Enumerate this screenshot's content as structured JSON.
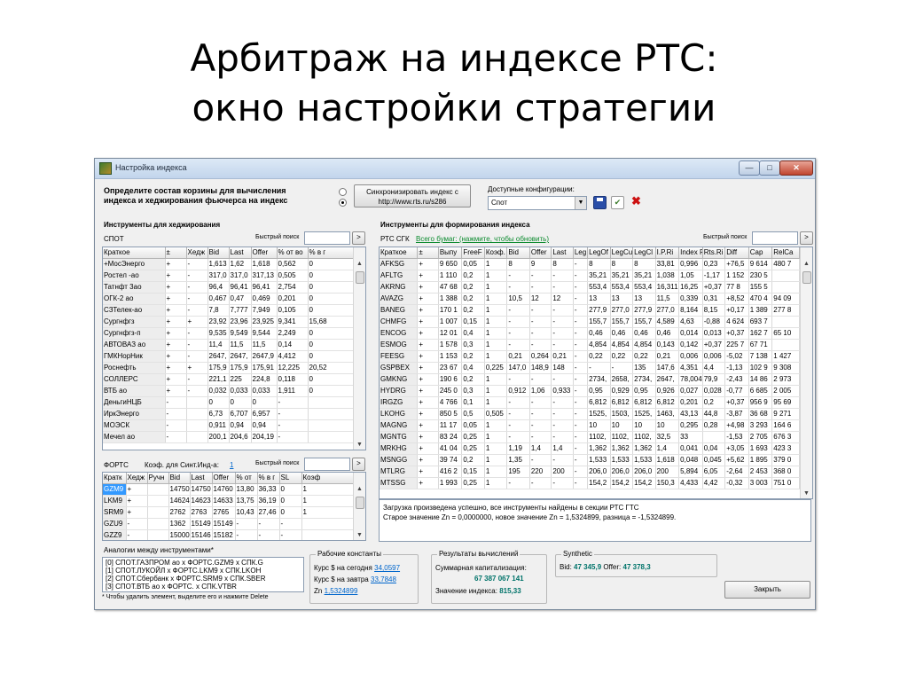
{
  "slide": {
    "title_line1": "Арбитраж на индексе РТС:",
    "title_line2": "окно настройки стратегии"
  },
  "window": {
    "title": "Настройка индекса",
    "min": "—",
    "max": "□",
    "close": "✕"
  },
  "top": {
    "define_line1": "Определите состав корзины для вычисления",
    "define_line2": "индекса и хеджирования фьючерса на индекс",
    "sync_line1": "Синхронизировать индекс с",
    "sync_line2": "http://www.rts.ru/s286",
    "configs_label": "Доступные конфигурации:",
    "config_value": "Спот",
    "config_arrow": "▼",
    "save_icon": "save-icon",
    "check_icon": "check-icon",
    "delete_icon": "delete-icon",
    "delete_glyph": "✖",
    "check_glyph": "✔"
  },
  "hedge": {
    "heading": "Инструменты для хеджирования",
    "section": "СПОТ",
    "quick_search": "Быстрый поиск",
    "go": ">",
    "columns": [
      "Краткое",
      "±",
      "Хедж",
      "Bid",
      "Last",
      "Offer",
      "% от во",
      "% в г"
    ],
    "rows": [
      [
        "+МосЭнерго",
        "+",
        "-",
        "1,613",
        "1,62",
        "1,618",
        "0,562",
        "0"
      ],
      [
        "Ростел -ао",
        "+",
        "-",
        "317,0",
        "317,0",
        "317,13",
        "0,505",
        "0"
      ],
      [
        "Татнфт 3ао",
        "+",
        "-",
        "96,4",
        "96,41",
        "96,41",
        "2,754",
        "0"
      ],
      [
        "ОГК-2 ао",
        "+",
        "-",
        "0,467",
        "0,47",
        "0,469",
        "0,201",
        "0"
      ],
      [
        "СЗТелек-ао",
        "+",
        "-",
        "7,8",
        "7,777",
        "7,949",
        "0,105",
        "0"
      ],
      [
        "Сургнфгз",
        "+",
        "+",
        "23,92",
        "23,96",
        "23,925",
        "9,341",
        "15,68"
      ],
      [
        "Сургнфгз-п",
        "+",
        "-",
        "9,535",
        "9,549",
        "9,544",
        "2,249",
        "0"
      ],
      [
        "АВТОВАЗ ао",
        "+",
        "-",
        "11,4",
        "11,5",
        "11,5",
        "0,14",
        "0"
      ],
      [
        "ГМКНорНик",
        "+",
        "-",
        "2647,",
        "2647,",
        "2647,9",
        "4,412",
        "0"
      ],
      [
        "Роснефть",
        "+",
        "+",
        "175,9",
        "175,9",
        "175,91",
        "12,225",
        "20,52"
      ],
      [
        "СОЛЛЕРС",
        "+",
        "-",
        "221,1",
        "225",
        "224,8",
        "0,118",
        "0"
      ],
      [
        "ВТБ ао",
        "+",
        "-",
        "0,032",
        "0,033",
        "0,033",
        "1,911",
        "0"
      ],
      [
        "ДеньгиНЦБ",
        "-",
        "",
        "0",
        "0",
        "0",
        "-",
        ""
      ],
      [
        "ИркЭнерго",
        "-",
        "",
        "6,73",
        "6,707",
        "6,957",
        "-",
        ""
      ],
      [
        "МОЭСК",
        "-",
        "",
        "0,911",
        "0,94",
        "0,94",
        "-",
        ""
      ],
      [
        "Мечел ао",
        "-",
        "",
        "200,1",
        "204,6",
        "204,19",
        "-",
        ""
      ]
    ]
  },
  "forts": {
    "section": "ФОРТС",
    "coef_label": "Коэф. для Синт.Инд-а:",
    "coef_value": "1",
    "quick_search": "Быстрый поиск",
    "go": ">",
    "columns": [
      "Кратк",
      "Хедж",
      "Ручн",
      "Bid",
      "Last",
      "Offer",
      "% от",
      "% в г",
      "SL",
      "Коэф"
    ],
    "rows": [
      [
        "GZM9",
        "+",
        "",
        "14750",
        "14750",
        "14760",
        "13,80",
        "36,33",
        "0",
        "1"
      ],
      [
        "LKM9",
        "+",
        "",
        "14624",
        "14623",
        "14633",
        "13,75",
        "36,19",
        "0",
        "1"
      ],
      [
        "SRM9",
        "+",
        "",
        "2762",
        "2763",
        "2765",
        "10,43",
        "27,46",
        "0",
        "1"
      ],
      [
        "GZU9",
        "-",
        "",
        "1362",
        "15149",
        "15149",
        "-",
        "-",
        "-",
        ""
      ],
      [
        "GZZ9",
        "-",
        "",
        "15000",
        "15146",
        "15182",
        "-",
        "-",
        "-",
        ""
      ]
    ]
  },
  "analogies": {
    "title": "Аналогии между инструментами*",
    "items": [
      "[0]  СПОТ.ГАЗПРОМ ао  x  ФОРТС.GZM9  x  СПК.G",
      "[1]  СПОТ.ЛУКОЙЛ  x  ФОРТС.LKM9  x  СПК.LKOH",
      "[2]  СПОТ.Сбербанк  x  ФОРТС.SRM9  x  СПК.SBER",
      "[3]  СПОТ.ВТБ ао  x  ФОРТС.  x  СПК.VTBR"
    ],
    "footnote": "* Чтобы удалить элемент, выделите его и нажмите Delete"
  },
  "index": {
    "heading": "Инструменты для формирования индекса",
    "section": "РТС СГК",
    "all_papers_link": "Всего бумаг: (нажмите, чтобы обновить)",
    "quick_search": "Быстрый поиск",
    "go": ">",
    "columns": [
      "Краткое",
      "±",
      "Выпу",
      "FreeF",
      "Коэф.",
      "Bid",
      "Offer",
      "Last",
      "Leg",
      "LegOf",
      "LegCu",
      "LegCl",
      "I.P.Ri",
      "Index P",
      "Rts.Ri",
      "Diff",
      "Cap",
      "RelCa"
    ],
    "rows": [
      [
        "AFKSG",
        "+",
        "9 650",
        "0,05",
        "1",
        "8",
        "9",
        "8",
        "-",
        "8",
        "8",
        "8",
        "33,81",
        "0,996",
        "0,23",
        "+76,5",
        "9 614",
        "480 7"
      ],
      [
        "AFLTG",
        "+",
        "1 110",
        "0,2",
        "1",
        "-",
        "-",
        "-",
        "-",
        "35,21",
        "35,21",
        "35,21",
        "1,038",
        "1,05",
        "-1,17",
        "1 152",
        "230 5"
      ],
      [
        "AKRNG",
        "+",
        "47 68",
        "0,2",
        "1",
        "-",
        "-",
        "-",
        "-",
        "553,4",
        "553,4",
        "553,4",
        "16,311",
        "16,25",
        "+0,37",
        "77 8",
        "155 5"
      ],
      [
        "AVAZG",
        "+",
        "1 388",
        "0,2",
        "1",
        "10,5",
        "12",
        "12",
        "-",
        "13",
        "13",
        "13",
        "11,5",
        "0,339",
        "0,31",
        "+8,52",
        "470 4",
        "94 09"
      ],
      [
        "BANEG",
        "+",
        "170 1",
        "0,2",
        "1",
        "-",
        "-",
        "-",
        "-",
        "277,9",
        "277,0",
        "277,9",
        "277,0",
        "8,164",
        "8,15",
        "+0,17",
        "1 389",
        "277 8"
      ],
      [
        "CHMFG",
        "+",
        "1 007",
        "0,15",
        "1",
        "-",
        "-",
        "-",
        "-",
        "155,7",
        "155,7",
        "155,7",
        "4,589",
        "4,63",
        "-0,88",
        "4 624",
        "693 7"
      ],
      [
        "ENCOG",
        "+",
        "12 01",
        "0,4",
        "1",
        "-",
        "-",
        "-",
        "-",
        "0,46",
        "0,46",
        "0,46",
        "0,46",
        "0,014",
        "0,013",
        "+0,37",
        "162 7",
        "65 10"
      ],
      [
        "ESMOG",
        "+",
        "1 578",
        "0,3",
        "1",
        "-",
        "-",
        "-",
        "-",
        "4,854",
        "4,854",
        "4,854",
        "0,143",
        "0,142",
        "+0,37",
        "225 7",
        "67 71"
      ],
      [
        "FEESG",
        "+",
        "1 153",
        "0,2",
        "1",
        "0,21",
        "0,264",
        "0,21",
        "-",
        "0,22",
        "0,22",
        "0,22",
        "0,21",
        "0,006",
        "0,006",
        "-5,02",
        "7 138",
        "1 427"
      ],
      [
        "GSPBEX",
        "+",
        "23 67",
        "0,4",
        "0,225",
        "147,0",
        "148,9",
        "148",
        "-",
        "-",
        "-",
        "135",
        "147,6",
        "4,351",
        "4,4",
        "-1,13",
        "102 9",
        "9 308"
      ],
      [
        "GMKNG",
        "+",
        "190 6",
        "0,2",
        "1",
        "-",
        "-",
        "-",
        "-",
        "2734,",
        "2658,",
        "2734,",
        "2647,",
        "78,004",
        "79,9",
        "-2,43",
        "14 86",
        "2 973"
      ],
      [
        "HYDRG",
        "+",
        "245 0",
        "0,3",
        "1",
        "0,912",
        "1,06",
        "0,933",
        "-",
        "0,95",
        "0,929",
        "0,95",
        "0,926",
        "0,027",
        "0,028",
        "-0,77",
        "6 685",
        "2 005"
      ],
      [
        "IRGZG",
        "+",
        "4 766",
        "0,1",
        "1",
        "-",
        "-",
        "-",
        "-",
        "6,812",
        "6,812",
        "6,812",
        "6,812",
        "0,201",
        "0,2",
        "+0,37",
        "956 9",
        "95 69"
      ],
      [
        "LKOHG",
        "+",
        "850 5",
        "0,5",
        "0,505",
        "-",
        "-",
        "-",
        "-",
        "1525,",
        "1503,",
        "1525,",
        "1463,",
        "43,13",
        "44,8",
        "-3,87",
        "36 68",
        "9 271"
      ],
      [
        "MAGNG",
        "+",
        "11 17",
        "0,05",
        "1",
        "-",
        "-",
        "-",
        "-",
        "10",
        "10",
        "10",
        "10",
        "0,295",
        "0,28",
        "+4,98",
        "3 293",
        "164 6"
      ],
      [
        "MGNTG",
        "+",
        "83 24",
        "0,25",
        "1",
        "-",
        "-",
        "-",
        "-",
        "1102,",
        "1102,",
        "1102,",
        "32,5",
        "33",
        "",
        "-1,53",
        "2 705",
        "676 3"
      ],
      [
        "MRKHG",
        "+",
        "41 04",
        "0,25",
        "1",
        "1,19",
        "1,4",
        "1,4",
        "-",
        "1,362",
        "1,362",
        "1,362",
        "1,4",
        "0,041",
        "0,04",
        "+3,05",
        "1 693",
        "423 3"
      ],
      [
        "MSNGG",
        "+",
        "39 74",
        "0,2",
        "1",
        "1,35",
        "-",
        "-",
        "-",
        "1,533",
        "1,533",
        "1,533",
        "1,618",
        "0,048",
        "0,045",
        "+5,62",
        "1 895",
        "379 0"
      ],
      [
        "MTLRG",
        "+",
        "416 2",
        "0,15",
        "1",
        "195",
        "220",
        "200",
        "-",
        "206,0",
        "206,0",
        "206,0",
        "200",
        "5,894",
        "6,05",
        "-2,64",
        "2 453",
        "368 0"
      ],
      [
        "MTSSG",
        "+",
        "1 993",
        "0,25",
        "1",
        "-",
        "-",
        "-",
        "-",
        "154,2",
        "154,2",
        "154,2",
        "150,3",
        "4,433",
        "4,42",
        "-0,32",
        "3 003",
        "751 0"
      ]
    ],
    "log_line1": "Загрузка произведена успешно, все инструменты найдены в секции РТС ГТС",
    "log_line2": "Старое значение Zn = 0,0000000, новое значение Zn = 1,5324899, разница = -1,5324899."
  },
  "constants": {
    "title": "Рабочие константы",
    "today_label": "Курс $ на сегодня",
    "today_value": "34,0597",
    "tomorrow_label": "Курс $ на завтра",
    "tomorrow_value": "33,7848",
    "zn_label": "Zn",
    "zn_value": "1,5324899"
  },
  "results": {
    "title": "Результаты вычислений",
    "cap_label": "Суммарная капитализация:",
    "cap_value": "67 387 067 141",
    "index_label": "Значение индекса:",
    "index_value": "815,33"
  },
  "synthetic": {
    "title": "Synthetic",
    "bid_label": "Bid:",
    "bid_value": "47 345,9",
    "offer_label": "Offer:",
    "offer_value": "47 378,3"
  },
  "close_button": "Закрыть",
  "colors": {
    "accent": "#3399ff",
    "green": "#0b8a2e",
    "teal": "#00736a",
    "link": "#0066cc",
    "delete_red": "#cc1111",
    "save_blue": "#2a4ea8"
  }
}
